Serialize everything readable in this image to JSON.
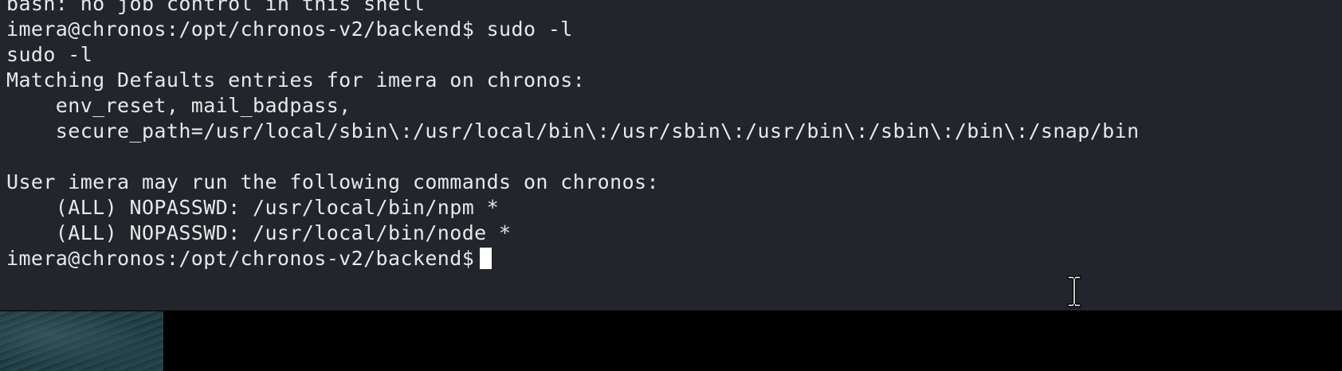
{
  "terminal": {
    "lines": [
      "bash: no job control in this shell",
      "imera@chronos:/opt/chronos-v2/backend$ sudo -l",
      "sudo -l",
      "Matching Defaults entries for imera on chronos:",
      "    env_reset, mail_badpass,",
      "    secure_path=/usr/local/sbin\\:/usr/local/bin\\:/usr/sbin\\:/usr/bin\\:/sbin\\:/bin\\:/snap/bin",
      "",
      "User imera may run the following commands on chronos:",
      "    (ALL) NOPASSWD: /usr/local/bin/npm *",
      "    (ALL) NOPASSWD: /usr/local/bin/node *"
    ],
    "prompt": "imera@chronos:/opt/chronos-v2/backend$",
    "background_color": "#22252b",
    "text_color": "#e8e8e8",
    "cursor_color": "#ffffff"
  },
  "icons": {
    "mouse_pointer": "text-ibeam-cursor-icon"
  }
}
